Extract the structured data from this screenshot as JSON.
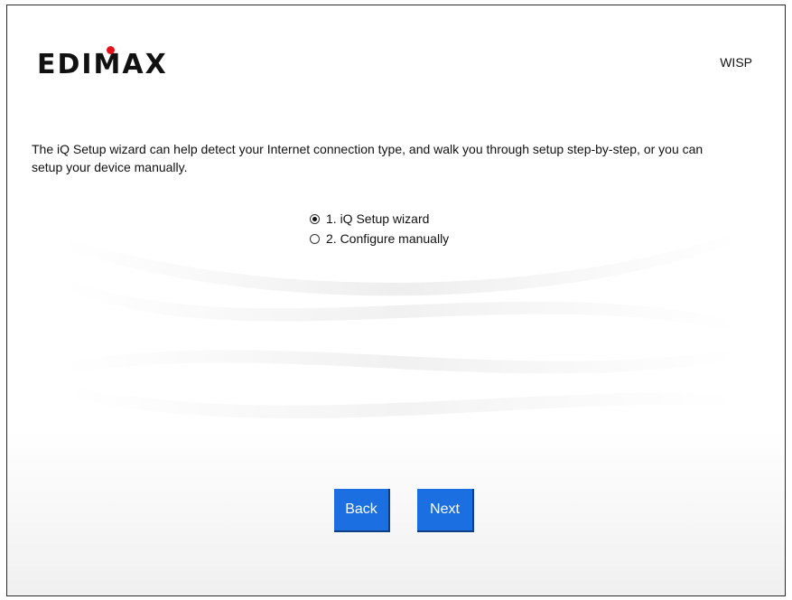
{
  "header": {
    "logo_text": "EDIMAX",
    "mode_label": "WISP"
  },
  "main": {
    "description": "The iQ Setup wizard can help detect your Internet connection type, and walk you through setup step-by-step, or you can setup your device manually.",
    "options": [
      {
        "label": "1. iQ Setup wizard",
        "checked": true
      },
      {
        "label": "2. Configure manually",
        "checked": false
      }
    ]
  },
  "buttons": {
    "back_label": "Back",
    "next_label": "Next"
  },
  "colors": {
    "button": "#1b6fe0",
    "logo_dot": "#e3131b"
  }
}
